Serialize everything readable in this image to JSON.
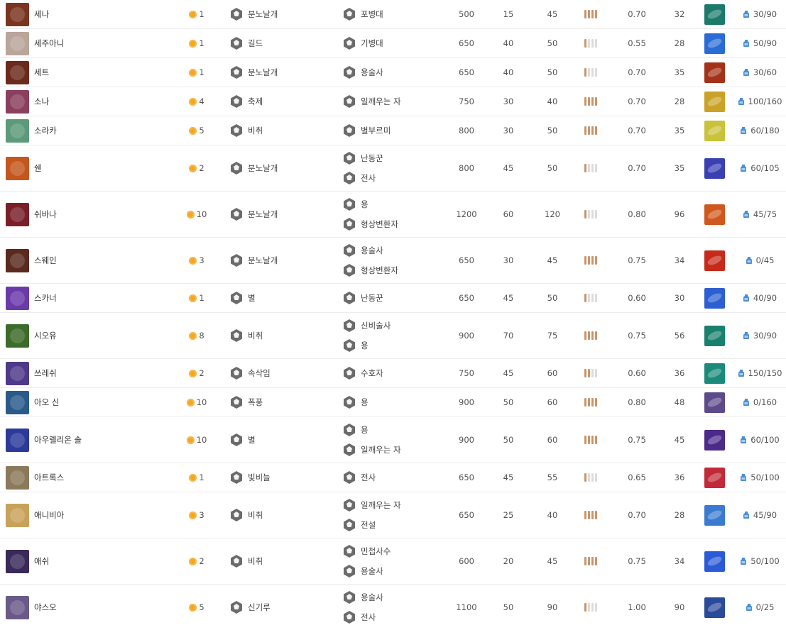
{
  "colors": {
    "coin": "#f5a623",
    "range_on": "#c9956b",
    "range_off": "#dcdcdc",
    "trait_icon": "#666666",
    "mana_icon": "#4a8fd6"
  },
  "rows": [
    {
      "name": "세나",
      "cost": "1",
      "origin": {
        "label": "분노날개",
        "icon": "wing-icon"
      },
      "classes": [
        {
          "label": "포병대",
          "icon": "cannon-icon"
        }
      ],
      "hp": "500",
      "ad": "15",
      "armor": "45",
      "range": 4,
      "as": "0.70",
      "sr": "32",
      "mana": "30/90",
      "portrait_color": "#7a3520",
      "skill_color": "#1b7a6a"
    },
    {
      "name": "세주아니",
      "cost": "1",
      "origin": {
        "label": "길드",
        "icon": "guild-icon"
      },
      "classes": [
        {
          "label": "기병대",
          "icon": "horse-icon"
        }
      ],
      "hp": "650",
      "ad": "40",
      "armor": "50",
      "range": 1,
      "as": "0.55",
      "sr": "28",
      "mana": "50/90",
      "portrait_color": "#b9a59a",
      "skill_color": "#2a6bd6"
    },
    {
      "name": "세트",
      "cost": "1",
      "origin": {
        "label": "분노날개",
        "icon": "wing-icon"
      },
      "classes": [
        {
          "label": "용술사",
          "icon": "dragonmancer-icon"
        }
      ],
      "hp": "650",
      "ad": "40",
      "armor": "50",
      "range": 1,
      "as": "0.70",
      "sr": "35",
      "mana": "30/60",
      "portrait_color": "#6b2a1c",
      "skill_color": "#a33318"
    },
    {
      "name": "소나",
      "cost": "4",
      "origin": {
        "label": "축제",
        "icon": "festival-icon"
      },
      "classes": [
        {
          "label": "일깨우는 자",
          "icon": "evoker-icon"
        }
      ],
      "hp": "750",
      "ad": "30",
      "armor": "40",
      "range": 4,
      "as": "0.70",
      "sr": "28",
      "mana": "100/160",
      "portrait_color": "#8a3f5e",
      "skill_color": "#c9a227"
    },
    {
      "name": "소라카",
      "cost": "5",
      "origin": {
        "label": "비취",
        "icon": "jade-icon"
      },
      "classes": [
        {
          "label": "별부르미",
          "icon": "starcaller-icon"
        }
      ],
      "hp": "800",
      "ad": "30",
      "armor": "50",
      "range": 4,
      "as": "0.70",
      "sr": "35",
      "mana": "60/180",
      "portrait_color": "#5c9a7a",
      "skill_color": "#c9c23a"
    },
    {
      "name": "쉔",
      "cost": "2",
      "origin": {
        "label": "분노날개",
        "icon": "wing-icon"
      },
      "classes": [
        {
          "label": "난동꾼",
          "icon": "bruiser-icon"
        },
        {
          "label": "전사",
          "icon": "warrior-icon"
        }
      ],
      "hp": "800",
      "ad": "45",
      "armor": "50",
      "range": 1,
      "as": "0.70",
      "sr": "35",
      "mana": "60/105",
      "portrait_color": "#c4571d",
      "skill_color": "#3a3fb3"
    },
    {
      "name": "쉬바나",
      "cost": "10",
      "origin": {
        "label": "분노날개",
        "icon": "wing-icon"
      },
      "classes": [
        {
          "label": "용",
          "icon": "dragon-icon"
        },
        {
          "label": "형상변환자",
          "icon": "shapeshifter-icon"
        }
      ],
      "hp": "1200",
      "ad": "60",
      "armor": "120",
      "range": 1,
      "as": "0.80",
      "sr": "96",
      "mana": "45/75",
      "portrait_color": "#7a1f2a",
      "skill_color": "#d0581d"
    },
    {
      "name": "스웨인",
      "cost": "3",
      "origin": {
        "label": "분노날개",
        "icon": "wing-icon"
      },
      "classes": [
        {
          "label": "용술사",
          "icon": "dragonmancer-icon"
        },
        {
          "label": "형상변환자",
          "icon": "shapeshifter-icon"
        }
      ],
      "hp": "650",
      "ad": "30",
      "armor": "45",
      "range": 4,
      "as": "0.75",
      "sr": "34",
      "mana": "0/45",
      "portrait_color": "#5a2a1e",
      "skill_color": "#c62a1a"
    },
    {
      "name": "스카너",
      "cost": "1",
      "origin": {
        "label": "별",
        "icon": "astral-icon"
      },
      "classes": [
        {
          "label": "난동꾼",
          "icon": "bruiser-icon"
        }
      ],
      "hp": "650",
      "ad": "45",
      "armor": "50",
      "range": 1,
      "as": "0.60",
      "sr": "30",
      "mana": "40/90",
      "portrait_color": "#6a3aa8",
      "skill_color": "#2c5fd1"
    },
    {
      "name": "시오유",
      "cost": "8",
      "origin": {
        "label": "비취",
        "icon": "jade-icon"
      },
      "classes": [
        {
          "label": "신비술사",
          "icon": "mystic-icon"
        },
        {
          "label": "용",
          "icon": "dragon-icon"
        }
      ],
      "hp": "900",
      "ad": "70",
      "armor": "75",
      "range": 4,
      "as": "0.75",
      "sr": "56",
      "mana": "30/90",
      "portrait_color": "#3d6b2a",
      "skill_color": "#18806c"
    },
    {
      "name": "쓰레쉬",
      "cost": "2",
      "origin": {
        "label": "속삭임",
        "icon": "whisper-icon"
      },
      "classes": [
        {
          "label": "수호자",
          "icon": "guardian-icon"
        }
      ],
      "hp": "750",
      "ad": "45",
      "armor": "60",
      "range": 2,
      "as": "0.60",
      "sr": "36",
      "mana": "150/150",
      "portrait_color": "#4f3a8a",
      "skill_color": "#1b8a7a"
    },
    {
      "name": "아오 신",
      "cost": "10",
      "origin": {
        "label": "폭풍",
        "icon": "tempest-icon"
      },
      "classes": [
        {
          "label": "용",
          "icon": "dragon-icon"
        }
      ],
      "hp": "900",
      "ad": "50",
      "armor": "60",
      "range": 4,
      "as": "0.80",
      "sr": "48",
      "mana": "0/160",
      "portrait_color": "#2a5a8a",
      "skill_color": "#5c4a8a"
    },
    {
      "name": "아우렐리온 솔",
      "cost": "10",
      "origin": {
        "label": "별",
        "icon": "astral-icon"
      },
      "classes": [
        {
          "label": "용",
          "icon": "dragon-icon"
        },
        {
          "label": "일깨우는 자",
          "icon": "evoker-icon"
        }
      ],
      "hp": "900",
      "ad": "50",
      "armor": "60",
      "range": 4,
      "as": "0.75",
      "sr": "45",
      "mana": "60/100",
      "portrait_color": "#2c3a9a",
      "skill_color": "#4b2a8a"
    },
    {
      "name": "아트록스",
      "cost": "1",
      "origin": {
        "label": "빛비늘",
        "icon": "shimmerscale-icon"
      },
      "classes": [
        {
          "label": "전사",
          "icon": "warrior-icon"
        }
      ],
      "hp": "650",
      "ad": "45",
      "armor": "55",
      "range": 1,
      "as": "0.65",
      "sr": "36",
      "mana": "50/100",
      "portrait_color": "#8a7a5a",
      "skill_color": "#c22a3a"
    },
    {
      "name": "애니비아",
      "cost": "3",
      "origin": {
        "label": "비취",
        "icon": "jade-icon"
      },
      "classes": [
        {
          "label": "일깨우는 자",
          "icon": "evoker-icon"
        },
        {
          "label": "전설",
          "icon": "legend-icon"
        }
      ],
      "hp": "650",
      "ad": "25",
      "armor": "40",
      "range": 4,
      "as": "0.70",
      "sr": "28",
      "mana": "45/90",
      "portrait_color": "#c9a25a",
      "skill_color": "#3a7ad1"
    },
    {
      "name": "애쉬",
      "cost": "2",
      "origin": {
        "label": "비취",
        "icon": "jade-icon"
      },
      "classes": [
        {
          "label": "민첩사수",
          "icon": "swiftshot-icon"
        },
        {
          "label": "용술사",
          "icon": "dragonmancer-icon"
        }
      ],
      "hp": "600",
      "ad": "20",
      "armor": "45",
      "range": 4,
      "as": "0.75",
      "sr": "34",
      "mana": "50/100",
      "portrait_color": "#3a2a5a",
      "skill_color": "#2a5ad6"
    },
    {
      "name": "야스오",
      "cost": "5",
      "origin": {
        "label": "신기루",
        "icon": "mirage-icon"
      },
      "classes": [
        {
          "label": "용술사",
          "icon": "dragonmancer-icon"
        },
        {
          "label": "전사",
          "icon": "warrior-icon"
        }
      ],
      "hp": "1100",
      "ad": "50",
      "armor": "90",
      "range": 1,
      "as": "1.00",
      "sr": "90",
      "mana": "0/25",
      "portrait_color": "#6a5a8a",
      "skill_color": "#2a4a9a"
    }
  ]
}
